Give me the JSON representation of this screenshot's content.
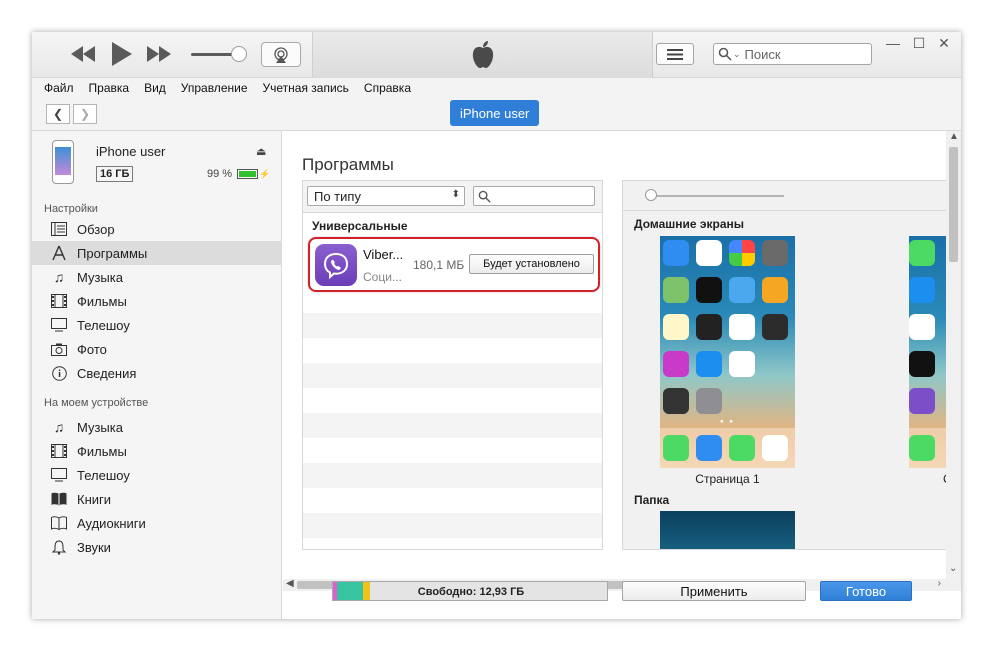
{
  "menu": [
    "Файл",
    "Правка",
    "Вид",
    "Управление",
    "Учетная запись",
    "Справка"
  ],
  "toolbar": {
    "search_placeholder": "Поиск"
  },
  "device": {
    "pill": "iPhone user",
    "name": "iPhone user",
    "capacity": "16 ГБ",
    "battery": "99 %",
    "battery_level": 0.99
  },
  "sidebar": {
    "settings_head": "Настройки",
    "settings_items": [
      "Обзор",
      "Программы",
      "Музыка",
      "Фильмы",
      "Телешоу",
      "Фото",
      "Сведения"
    ],
    "device_head": "На моем устройстве",
    "device_items": [
      "Музыка",
      "Фильмы",
      "Телешоу",
      "Книги",
      "Аудиокниги",
      "Звуки"
    ]
  },
  "main": {
    "title": "Программы",
    "sort_label": "По типу",
    "group_head": "Универсальные",
    "app": {
      "name": "Viber...",
      "category": "Соци...",
      "size": "180,1 МБ",
      "action": "Будет установлено"
    },
    "screens_head": "Домашние экраны",
    "screen1_label": "Страница 1",
    "screen2_label": "С",
    "folder_head": "Папка"
  },
  "footer": {
    "free_label": "Свободно: 12,93 ГБ",
    "apply": "Применить",
    "done": "Готово"
  },
  "colors": {
    "accent": "#2f7fd8",
    "highlight": "#d3202a",
    "viber": "#7b4fc8"
  }
}
